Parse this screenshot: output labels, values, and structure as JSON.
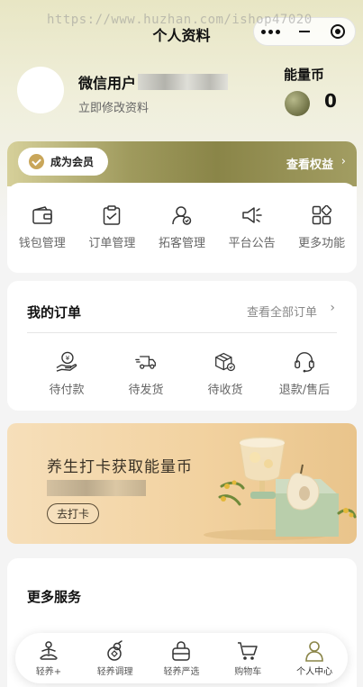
{
  "watermark": "https://www.huzhan.com/ishop47020",
  "header": {
    "title": "个人资料"
  },
  "user": {
    "name": "微信用户",
    "edit_link": "立即修改资料",
    "energy_label": "能量币",
    "energy_value": "0"
  },
  "vip": {
    "badge_label": "成为会员",
    "rights_link": "查看权益",
    "tools": [
      {
        "label": "钱包管理",
        "icon": "wallet-icon"
      },
      {
        "label": "订单管理",
        "icon": "order-list-icon"
      },
      {
        "label": "拓客管理",
        "icon": "user-manage-icon"
      },
      {
        "label": "平台公告",
        "icon": "megaphone-icon"
      },
      {
        "label": "更多功能",
        "icon": "grid-icon"
      }
    ]
  },
  "orders": {
    "title": "我的订单",
    "view_all": "查看全部订单",
    "statuses": [
      {
        "label": "待付款",
        "icon": "pay-icon"
      },
      {
        "label": "待发货",
        "icon": "truck-icon"
      },
      {
        "label": "待收货",
        "icon": "box-icon"
      },
      {
        "label": "退款/售后",
        "icon": "headset-icon"
      }
    ]
  },
  "banner": {
    "title": "养生打卡获取能量币",
    "button": "去打卡"
  },
  "more_services": {
    "title": "更多服务"
  },
  "tabbar": {
    "items": [
      {
        "label": "轻养+",
        "icon": "meditation-icon"
      },
      {
        "label": "轻养调理",
        "icon": "gourd-icon"
      },
      {
        "label": "轻养严选",
        "icon": "bag-icon"
      },
      {
        "label": "购物车",
        "icon": "cart-icon"
      },
      {
        "label": "个人中心",
        "icon": "person-icon"
      }
    ],
    "active_index": 4
  },
  "colors": {
    "accent_olive": "#8a8548",
    "background": "#f4f4f4"
  }
}
